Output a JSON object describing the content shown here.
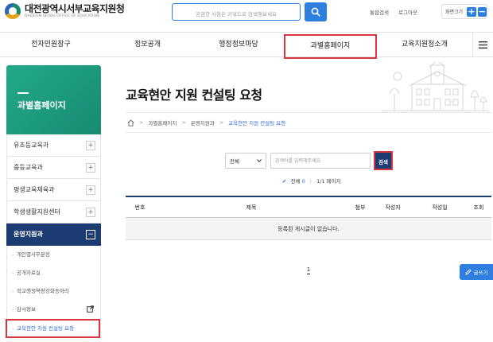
{
  "header": {
    "logo_ko": "대전광역시서부교육지원청",
    "logo_en": "DAEJEON SEOBU OFFICE OF EDUCATION",
    "search_placeholder": "궁금한 사항은 키워드로 검색해보세요",
    "util_links": [
      "통합검색",
      "로그아웃"
    ],
    "zoom_label": "화면크기",
    "zoom_in": "+",
    "zoom_out": "−"
  },
  "gnb": {
    "items": [
      "전자민원창구",
      "정보공개",
      "행정정보마당",
      "과별홈페이지",
      "교육지원청소개"
    ],
    "highlighted": "과별홈페이지"
  },
  "sidebar": {
    "title": "과별홈페이지",
    "items": [
      {
        "label": "유초등교육과",
        "toggle": "+"
      },
      {
        "label": "중등교육과",
        "toggle": "+"
      },
      {
        "label": "평생교육체육과",
        "toggle": "+"
      },
      {
        "label": "학생생활지원센터",
        "toggle": "+"
      },
      {
        "label": "운영지원과",
        "toggle": "−",
        "active": true
      }
    ],
    "sub_items": [
      {
        "label": "개인별사무분장"
      },
      {
        "label": "공개자료실"
      },
      {
        "label": "학교행정역량강화동아리"
      },
      {
        "label": "감사정보",
        "external": true
      },
      {
        "label": "교육현안 지원 컨설팅 요청",
        "current": true
      }
    ]
  },
  "content": {
    "title": "교육현안 지원 컨설팅 요청",
    "breadcrumb": [
      "과별홈페이지",
      "운영지원과",
      "교육현안 지원 컨설팅 요청"
    ],
    "search": {
      "scope_value": "전체",
      "keyword_placeholder": "검색어를 입력해주세요",
      "submit_label": "검색"
    },
    "count": {
      "total_label": "전체",
      "total": "0",
      "page_info": "1/1 페이지"
    },
    "table": {
      "columns": [
        "번호",
        "제목",
        "첨부",
        "작성자",
        "작성일",
        "조회"
      ],
      "empty_message": "등록된 게시글이 없습니다."
    },
    "pagination": {
      "current": "1"
    },
    "write_label": "글쓰기"
  },
  "colors": {
    "accent_blue": "#2f7fe0",
    "navy": "#1e3c74",
    "sidebar_green": "#1a9b7f",
    "highlight_red": "#d9373d",
    "link_blue": "#2f6bd1"
  }
}
